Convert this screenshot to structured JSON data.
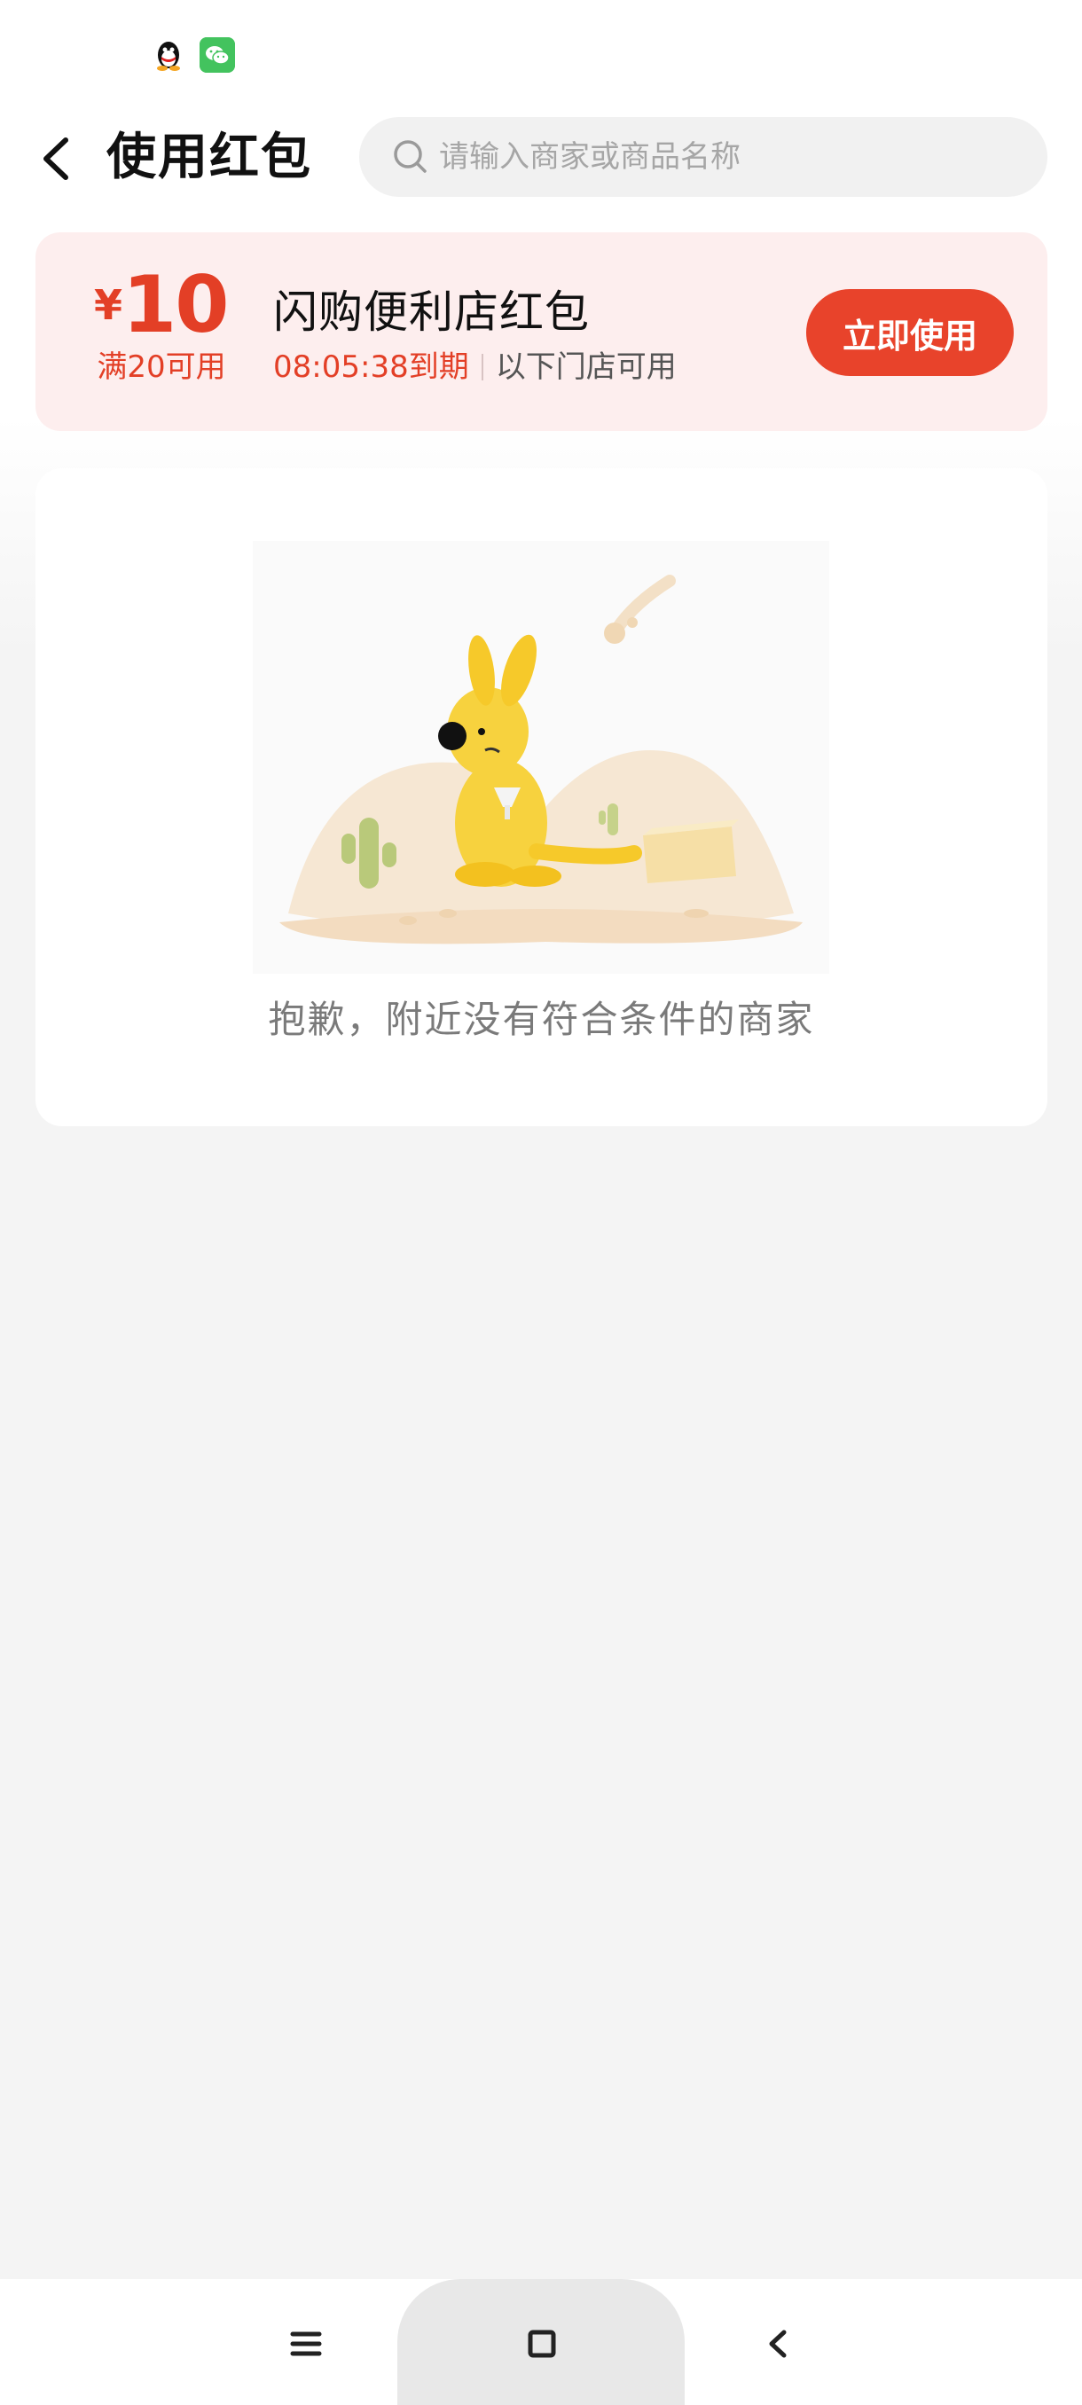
{
  "header": {
    "title": "使用红包",
    "search_placeholder": "请输入商家或商品名称"
  },
  "coupon": {
    "currency": "¥",
    "amount": "10",
    "condition": "满20可用",
    "title": "闪购便利店红包",
    "expire": "08:05:38到期",
    "scope": "以下门店可用",
    "use_button": "立即使用"
  },
  "empty": {
    "message": "抱歉，附近没有符合条件的商家"
  },
  "colors": {
    "accent": "#e33f26",
    "button": "#e8432b",
    "coupon_bg": "#fdeeee"
  },
  "icons": {
    "status": [
      "qq-icon",
      "wechat-icon"
    ],
    "nav": [
      "menu-icon",
      "home-square-icon",
      "back-arrow-icon"
    ]
  }
}
